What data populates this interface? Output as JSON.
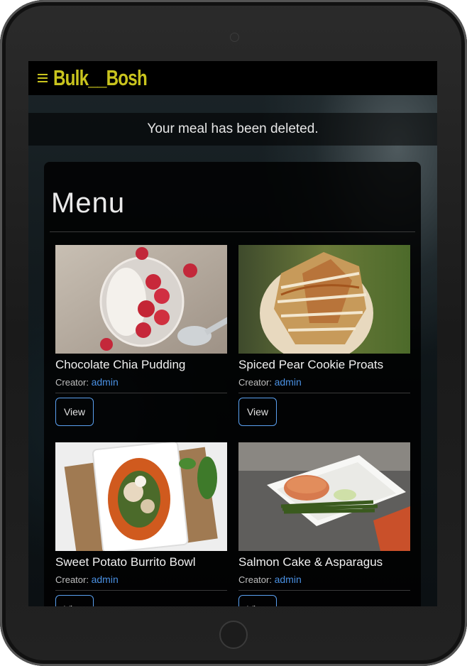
{
  "app": {
    "brand": "Bulk__Bosh"
  },
  "alert": {
    "message": "Your meal has been deleted."
  },
  "menu": {
    "title": "Menu",
    "creator_label": "Creator:",
    "items": [
      {
        "name": "Chocolate Chia Pudding",
        "creator": "admin",
        "view_label": "View"
      },
      {
        "name": "Spiced Pear Cookie Proats",
        "creator": "admin",
        "view_label": "View"
      },
      {
        "name": "Sweet Potato Burrito Bowl",
        "creator": "admin",
        "view_label": "View"
      },
      {
        "name": "Salmon Cake & Asparagus",
        "creator": "admin",
        "view_label": "View"
      }
    ]
  },
  "colors": {
    "brand": "#c9c41e",
    "link": "#4a90e2",
    "button_border": "#5aa0f0"
  },
  "icons": {
    "menu_toggle": "hamburger-icon"
  }
}
